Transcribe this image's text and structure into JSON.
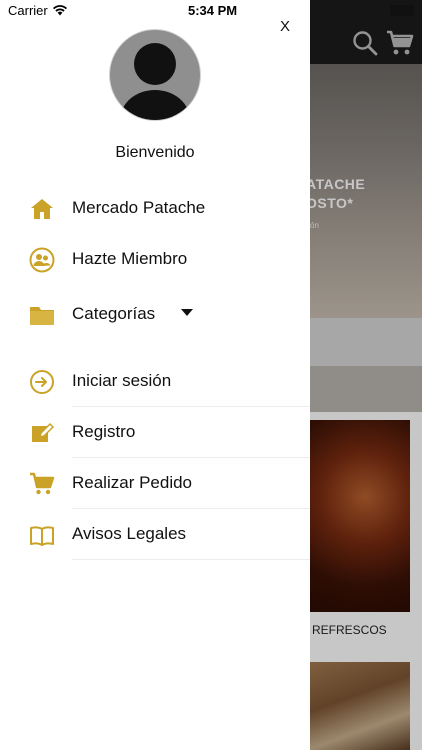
{
  "status_bar": {
    "carrier": "Carrier",
    "time": "5:34 PM"
  },
  "drawer": {
    "close_label": "X",
    "welcome": "Bienvenido",
    "items": [
      {
        "label": "Mercado Patache",
        "icon": "home-icon"
      },
      {
        "label": "Hazte Miembro",
        "icon": "members-icon"
      },
      {
        "label": "Categorías",
        "icon": "folder-icon",
        "expandable": true
      },
      {
        "label": "Iniciar sesión",
        "icon": "login-icon"
      },
      {
        "label": "Registro",
        "icon": "edit-icon"
      },
      {
        "label": "Realizar Pedido",
        "icon": "cart-icon"
      },
      {
        "label": "Avisos Legales",
        "icon": "book-icon"
      }
    ]
  },
  "background": {
    "hero_title": "ATACHE\nOSTO*",
    "hero_sub": "ón",
    "card_label": "REFRESCOS"
  },
  "colors": {
    "accent": "#C9A227",
    "drawer_bg": "#FFFFFF",
    "topbar": "#1C1C1C"
  }
}
